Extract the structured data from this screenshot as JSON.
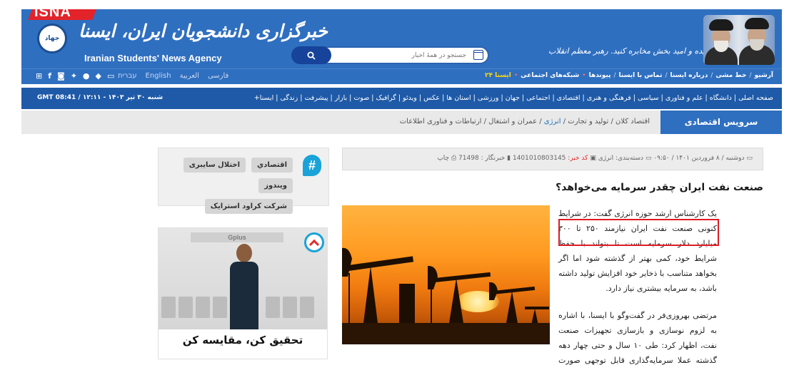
{
  "header": {
    "brand_tab": "ISNA",
    "brand_fa": "خبرگزاری دانشجویان ایران، ایسنا",
    "brand_en": "Iranian Students' News Agency",
    "emblem": "جهاد",
    "slogan": "اخبار خوب، منیده و امید بخش مخابره کنید. رهبر معظم انقلاب",
    "search": {
      "placeholder": "جستجو در همهٔ اخبار"
    }
  },
  "nav_top": {
    "social_icons": [
      "archive-icon",
      "facebook-icon",
      "instagram-icon",
      "twitter-icon",
      "apple-icon",
      "android-icon",
      "monitor-icon"
    ],
    "languages": [
      "עברית",
      "English",
      "العربية",
      "فارسی"
    ],
    "links": [
      "آرشیو",
      "خط مشی",
      "درباره ایسنا",
      "تماس با ایسنا",
      "پیوندها",
      "شبکه‌های اجتماعی",
      "ایسنا ۲۴"
    ]
  },
  "category_bar": {
    "datetime": "شنبه ۳۰ تیر ۱۴۰۳ - ۱۲:۱۱ / GMT 08:41",
    "categories": "صفحه اصلی | دانشگاه | علم و فناوری | سیاسی | فرهنگی و هنری | اقتصادی | اجتماعی | جهان | ورزشی | استان ها | عکس | ویدئو | گرافیک | صوت | بازار | پیشرفت | زندگی | ایسنا+"
  },
  "service": {
    "title": "سرویس اقتصادی",
    "links": [
      "اقتصاد کلان",
      "تولید و تجارت",
      "انرژی",
      "عمران و اشتغال",
      "ارتباطات و فناوری اطلاعات"
    ]
  },
  "meta": {
    "date": "دوشنبه / ۸ فروردین ۱۴۰۱ / ۰۹:۵۰",
    "category_label": "دسته‌بندی: انرژی",
    "code_label": "کد خبر:",
    "code": "1401010803145",
    "reporter_label": "خبرنگار :",
    "reporter": "71498",
    "print": "چاپ"
  },
  "article": {
    "headline": "صنعت نفت ایران چقدر سرمایه می‌خواهد؟",
    "para1": "یک کارشناس ارشد حوزه انرژی گفت: در شرایط کنونی صنعت نفت ایران نیازمند ۲۵۰ تا ۳۰۰ میلیارد دلار سرمایه است تا بتواند با حفظ شرایط خود، کمی بهتر از گذشته شود اما اگر بخواهد متناسب با ذخایر خود افزایش تولید داشته باشد، به سرمایه بیشتری نیاز دارد.",
    "para2": "مرتضی بهروزی‌فر در گفت‌وگو با ایسنا، با اشاره به لزوم نوسازی و بازسازی تجهیزات صنعت نفت، اظهار کرد: طی ۱۰ سال و حتی چهار دهه گذشته عملا سرمایه‌گذاری قابل توجهی صورت نگرفته است."
  },
  "sidebar": {
    "tags": [
      "اقتصادي",
      "اختلال سایبری",
      "ویندوز",
      "شرکت کراود استرایک"
    ],
    "ad": {
      "store_sign": "Gplus",
      "caption": "تحقیق کن، مقایسه کن"
    }
  },
  "colors": {
    "header_blue": "#2f6fc0",
    "dark_blue": "#1e5aa8",
    "isna_red": "#e3232a",
    "highlight_red": "#e01b24",
    "accent_cyan": "#1aa3d8"
  }
}
